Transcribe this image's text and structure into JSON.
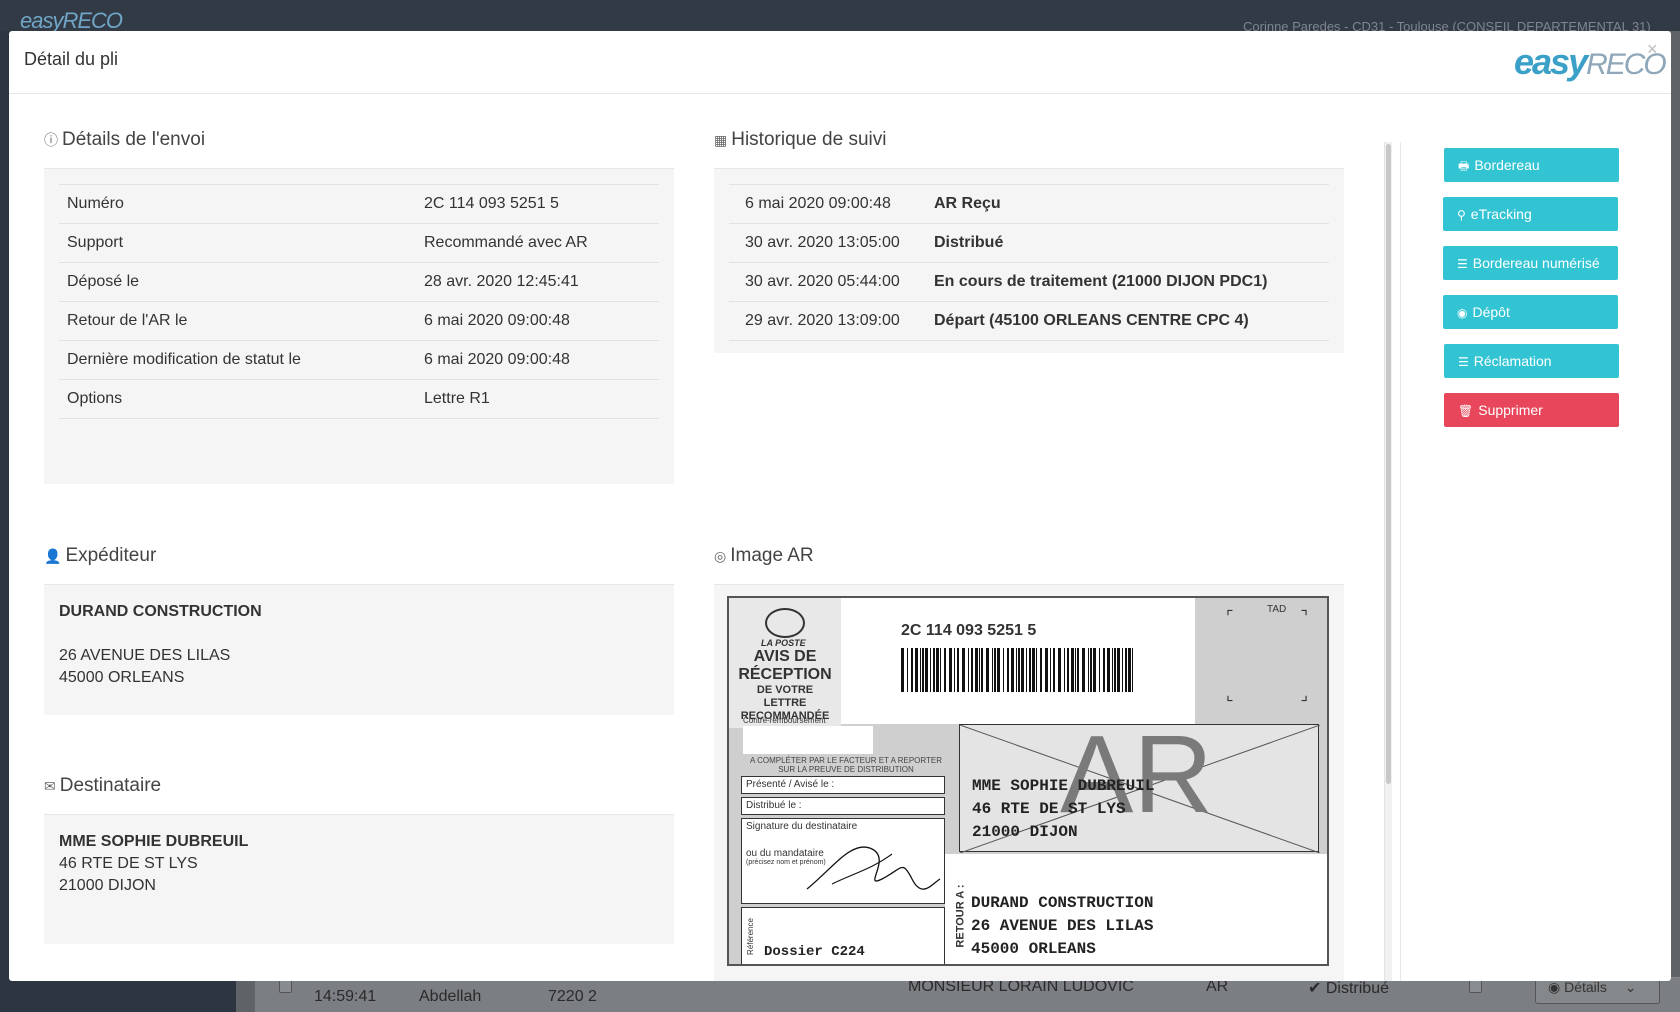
{
  "background": {
    "logo": "easyRECO",
    "user": "Corinne Paredes - CD31 - Toulouse (CONSEIL DEPARTEMENTAL 31)",
    "row": {
      "time": "14:59:41",
      "name": "Abdellah",
      "code": "7220 2",
      "recipient": "MONSIEUR LORAIN LUDOVIC",
      "type": "AR",
      "status": "Distribué",
      "details_label": "Détails"
    }
  },
  "modal": {
    "title": "Détail du pli",
    "logo_easy": "easy",
    "logo_reco": "RECO",
    "close": "×"
  },
  "details": {
    "title": "Détails de l'envoi",
    "rows": [
      {
        "label": "Numéro",
        "value": "2C 114 093 5251 5"
      },
      {
        "label": "Support",
        "value": "Recommandé avec AR"
      },
      {
        "label": "Déposé le",
        "value": "28 avr. 2020 12:45:41"
      },
      {
        "label": "Retour de l'AR le",
        "value": "6 mai 2020 09:00:48"
      },
      {
        "label": "Dernière modification de statut le",
        "value": "6 mai 2020 09:00:48"
      },
      {
        "label": "Options",
        "value": "Lettre R1"
      }
    ]
  },
  "history": {
    "title": "Historique de suivi",
    "rows": [
      {
        "date": "6 mai 2020 09:00:48",
        "event": "AR Reçu"
      },
      {
        "date": "30 avr. 2020 13:05:00",
        "event": "Distribué"
      },
      {
        "date": "30 avr. 2020 05:44:00",
        "event": "En cours de traitement (21000 DIJON PDC1)"
      },
      {
        "date": "29 avr. 2020 13:09:00",
        "event": "Départ (45100 ORLEANS CENTRE CPC 4)"
      }
    ]
  },
  "sender": {
    "title": "Expéditeur",
    "name": "DURAND CONSTRUCTION",
    "line1": "26 AVENUE DES LILAS",
    "line2": "45000 ORLEANS"
  },
  "recipient": {
    "title": "Destinataire",
    "name": "MME SOPHIE DUBREUIL",
    "line1": "46 RTE DE ST LYS",
    "line2": "21000 DIJON"
  },
  "image_ar": {
    "title": "Image AR",
    "tracking": "2C 114 093 5251 5",
    "la_poste": "LA POSTE",
    "avis1": "AVIS DE",
    "avis2": "RÉCEPTION",
    "avis3": "DE VOTRE LETTRE",
    "avis4": "RECOMMANDÉE",
    "contre": "Contre-remboursement",
    "tad": "TAD",
    "completer": "A COMPLÉTER PAR LE FACTEUR ET A REPORTER SUR LA PREUVE DE DISTRIBUTION",
    "presente": "Présenté / Avisé le :",
    "distribue": "Distribué le :",
    "signature": "Signature du destinataire",
    "mandataire": "ou du mandataire",
    "precisez": "(précisez nom et prénom)",
    "reference": "Référence",
    "dossier": "Dossier C224",
    "retour": "RETOUR A :",
    "ar_big": "AR",
    "dest1": "MME SOPHIE DUBREUIL",
    "dest2": "46 RTE DE ST LYS",
    "dest3": "21000 DIJON",
    "ret1": "DURAND CONSTRUCTION",
    "ret2": "26 AVENUE DES LILAS",
    "ret3": "45000 ORLEANS"
  },
  "actions": [
    {
      "label": "Bordereau",
      "icon": "print-icon",
      "glyph": "🖶",
      "style": "info"
    },
    {
      "label": "eTracking",
      "icon": "map-marker-icon",
      "glyph": "⚲",
      "style": "info"
    },
    {
      "label": "Bordereau numérisé",
      "icon": "list-icon",
      "glyph": "☰",
      "style": "info"
    },
    {
      "label": "Dépôt",
      "icon": "eye-icon",
      "glyph": "◉",
      "style": "info"
    },
    {
      "label": "Réclamation",
      "icon": "list-icon",
      "glyph": "☰",
      "style": "info"
    },
    {
      "label": "Supprimer",
      "icon": "trash-icon",
      "glyph": "🗑",
      "style": "danger"
    }
  ],
  "colors": {
    "info": "#33c4d4",
    "danger": "#e8475b"
  }
}
